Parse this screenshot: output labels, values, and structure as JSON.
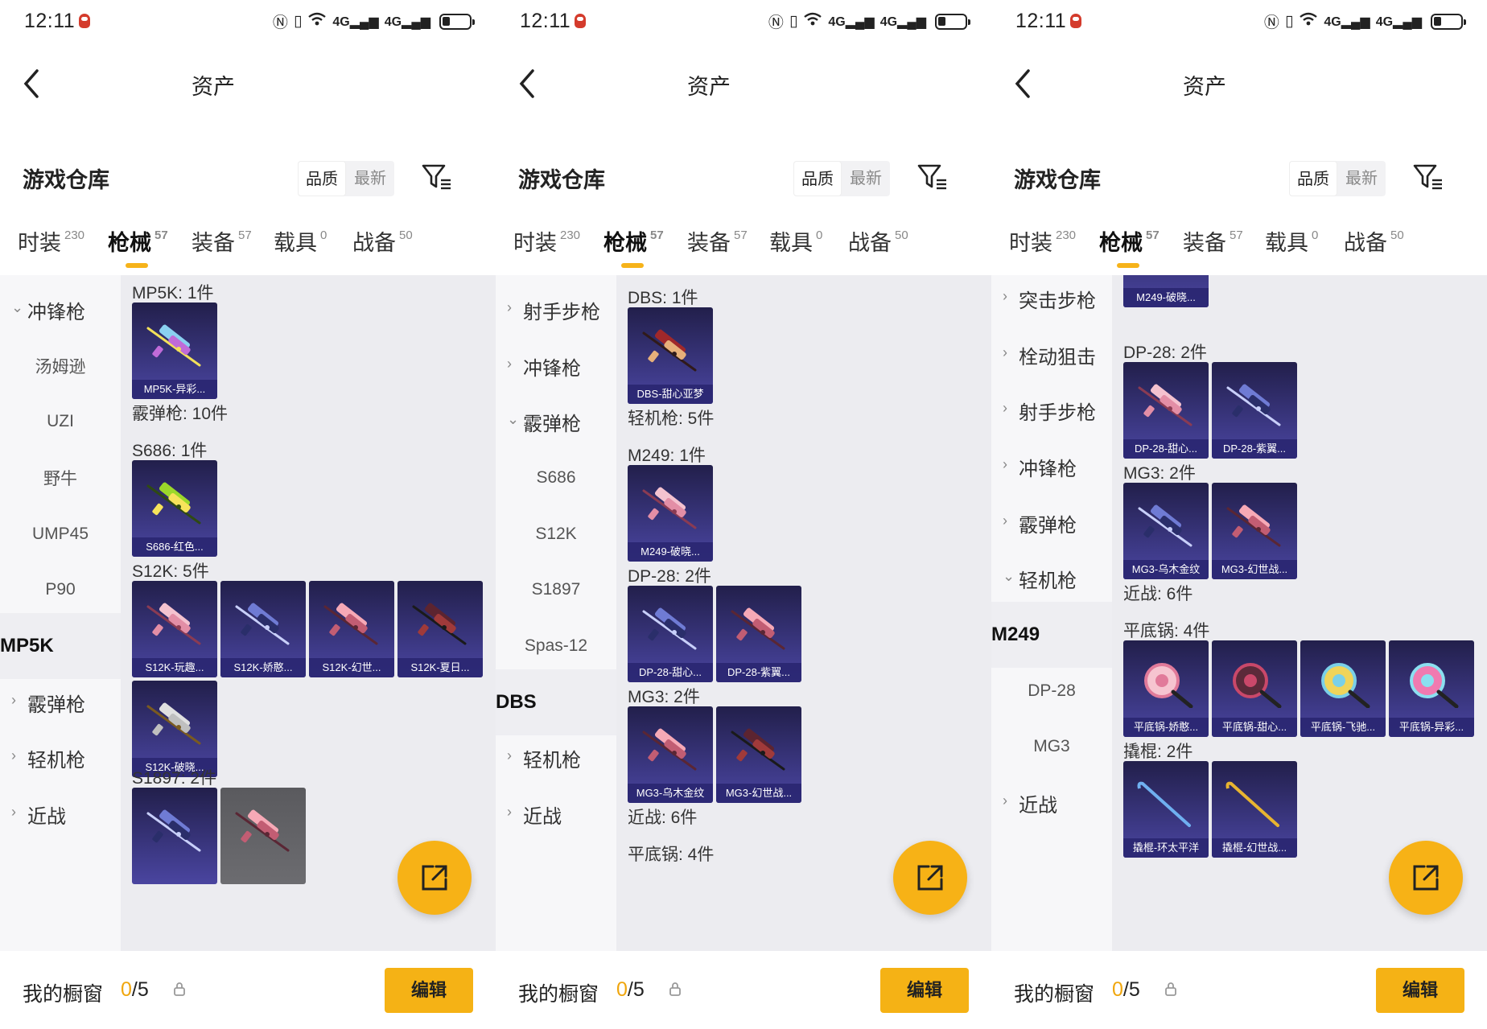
{
  "colors": {
    "accent": "#f6b31a",
    "card_bg": "#3e3a88",
    "panel_bg": "#f3f3f6"
  },
  "icons": [
    "back-arrow-icon",
    "filter-icon",
    "share-icon",
    "lock-icon",
    "battery-icon",
    "wifi-icon",
    "signal-icon"
  ],
  "status": {
    "time": "12:11",
    "net1": "4G",
    "net2": "4G"
  },
  "nav": {
    "title": "资产"
  },
  "header": {
    "title": "游戏仓库",
    "sort_quality": "品质",
    "sort_latest": "最新"
  },
  "tabs": [
    {
      "label": "时装",
      "count": "230"
    },
    {
      "label": "枪械",
      "count": "57"
    },
    {
      "label": "装备",
      "count": "57"
    },
    {
      "label": "载具",
      "count": "0"
    },
    {
      "label": "战备",
      "count": "50"
    }
  ],
  "footer": {
    "label": "我的橱窗",
    "count_current": "0",
    "count_total": "/5",
    "edit": "编辑"
  },
  "panels": [
    {
      "sidebar": [
        {
          "label": "冲锋枪",
          "kind": "parent",
          "open": true
        },
        {
          "label": "汤姆逊",
          "kind": "child"
        },
        {
          "label": "UZI",
          "kind": "child"
        },
        {
          "label": "野牛",
          "kind": "child"
        },
        {
          "label": "UMP45",
          "kind": "child"
        },
        {
          "label": "P90",
          "kind": "child"
        },
        {
          "label": "MP5K",
          "kind": "selected"
        },
        {
          "label": "霰弹枪",
          "kind": "parent"
        },
        {
          "label": "轻机枪",
          "kind": "parent"
        },
        {
          "label": "近战",
          "kind": "parent"
        }
      ],
      "content": [
        {
          "label": "MP5K: 1件",
          "items": [
            "MP5K-异彩..."
          ]
        },
        {
          "label": "霰弹枪: 10件",
          "items": []
        },
        {
          "label": "S686: 1件",
          "items": [
            "S686-红色..."
          ]
        },
        {
          "label": "S12K: 5件",
          "items": [
            "S12K-玩趣...",
            "S12K-娇憨...",
            "S12K-幻世...",
            "S12K-夏日...",
            "S12K-破晓..."
          ]
        },
        {
          "label": "S1897: 2件",
          "items": [
            "",
            ""
          ]
        }
      ]
    },
    {
      "sidebar": [
        {
          "label": "射手步枪",
          "kind": "parent"
        },
        {
          "label": "冲锋枪",
          "kind": "parent"
        },
        {
          "label": "霰弹枪",
          "kind": "parent",
          "open": true
        },
        {
          "label": "S686",
          "kind": "child"
        },
        {
          "label": "S12K",
          "kind": "child"
        },
        {
          "label": "S1897",
          "kind": "child"
        },
        {
          "label": "Spas-12",
          "kind": "child"
        },
        {
          "label": "DBS",
          "kind": "selected"
        },
        {
          "label": "轻机枪",
          "kind": "parent"
        },
        {
          "label": "近战",
          "kind": "parent"
        }
      ],
      "content": [
        {
          "label": "DBS: 1件",
          "items": [
            "DBS-甜心亚梦"
          ]
        },
        {
          "label": "轻机枪: 5件",
          "items": []
        },
        {
          "label": "M249: 1件",
          "items": [
            "M249-破晓..."
          ]
        },
        {
          "label": "DP-28: 2件",
          "items": [
            "DP-28-甜心...",
            "DP-28-紫翼..."
          ]
        },
        {
          "label": "MG3: 2件",
          "items": [
            "MG3-乌木金纹",
            "MG3-幻世战..."
          ]
        },
        {
          "label": "近战: 6件",
          "items": []
        },
        {
          "label": "平底锅: 4件",
          "items": []
        }
      ]
    },
    {
      "sidebar": [
        {
          "label": "突击步枪",
          "kind": "parent"
        },
        {
          "label": "栓动狙击",
          "kind": "parent"
        },
        {
          "label": "射手步枪",
          "kind": "parent"
        },
        {
          "label": "冲锋枪",
          "kind": "parent"
        },
        {
          "label": "霰弹枪",
          "kind": "parent"
        },
        {
          "label": "轻机枪",
          "kind": "parent",
          "open": true
        },
        {
          "label": "M249",
          "kind": "selected"
        },
        {
          "label": "DP-28",
          "kind": "child"
        },
        {
          "label": "MG3",
          "kind": "child"
        },
        {
          "label": "近战",
          "kind": "parent"
        }
      ],
      "content": [
        {
          "label": "",
          "items": [
            "M249-破晓..."
          ]
        },
        {
          "label": "DP-28: 2件",
          "items": [
            "DP-28-甜心...",
            "DP-28-紫翼..."
          ]
        },
        {
          "label": "MG3: 2件",
          "items": [
            "MG3-乌木金纹",
            "MG3-幻世战..."
          ]
        },
        {
          "label": "近战: 6件",
          "items": []
        },
        {
          "label": "平底锅: 4件",
          "items": [
            "平底锅-娇憨...",
            "平底锅-甜心...",
            "平底锅-飞驰...",
            "平底锅-异彩..."
          ]
        },
        {
          "label": "撬棍: 2件",
          "items": [
            "撬棍-环太平洋",
            "撬棍-幻世战..."
          ]
        }
      ]
    }
  ]
}
